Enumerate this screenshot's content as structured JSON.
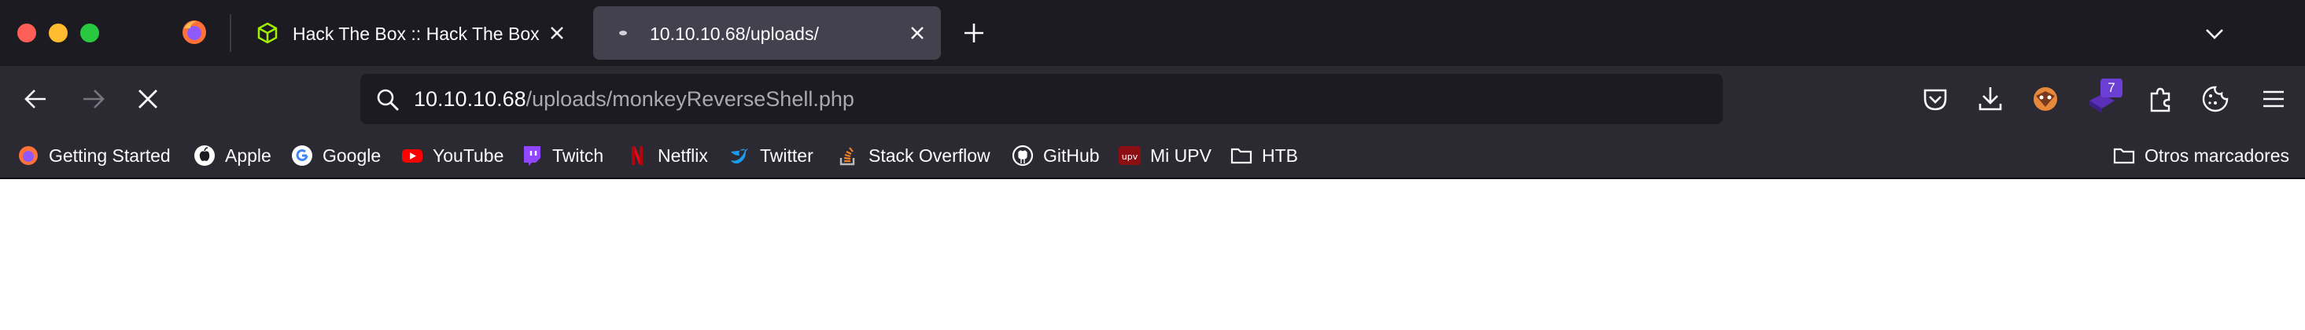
{
  "window": {
    "tabs": [
      {
        "title": "Hack The Box :: Hack The Box",
        "icon": "htb-cube-icon",
        "active": false
      },
      {
        "title": "10.10.10.68/uploads/",
        "icon": "loading-dot-icon",
        "active": true
      }
    ]
  },
  "navbar": {
    "url_host": "10.10.10.68",
    "url_path": "/uploads/monkeyReverseShell.php",
    "extension_badge": "7"
  },
  "bookmarks": {
    "items": [
      {
        "label": "Getting Started",
        "icon": "firefox-icon"
      },
      {
        "label": "Apple",
        "icon": "apple-icon"
      },
      {
        "label": "Google",
        "icon": "google-icon"
      },
      {
        "label": "YouTube",
        "icon": "youtube-icon"
      },
      {
        "label": "Twitch",
        "icon": "twitch-icon"
      },
      {
        "label": "Netflix",
        "icon": "netflix-icon"
      },
      {
        "label": "Twitter",
        "icon": "twitter-icon"
      },
      {
        "label": "Stack Overflow",
        "icon": "stackoverflow-icon"
      },
      {
        "label": "GitHub",
        "icon": "github-icon"
      },
      {
        "label": "Mi UPV",
        "icon": "upv-icon",
        "icon_text": "upv"
      },
      {
        "label": "HTB",
        "icon": "folder-icon"
      }
    ],
    "other": {
      "label": "Otros marcadores",
      "icon": "folder-icon"
    }
  },
  "colors": {
    "titlebar": "#1c1b22",
    "toolbar": "#2b2a33",
    "active_tab": "#42414d",
    "text": "#fbfbfe",
    "url_path": "#a9a9b3"
  }
}
